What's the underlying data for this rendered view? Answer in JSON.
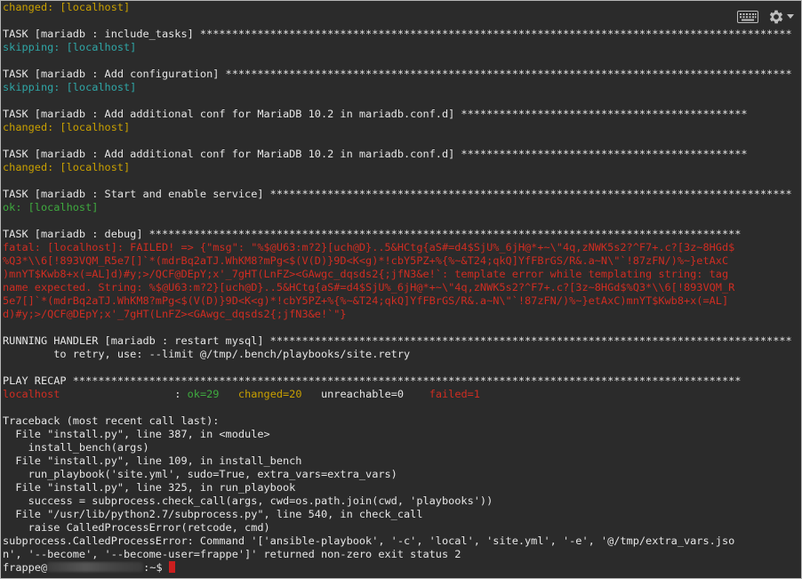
{
  "icons": {
    "keyboard": "keyboard-icon",
    "settings": "gear-icon",
    "dropdown": "caret-down-icon"
  },
  "colors": {
    "background": "#2b2b2b",
    "text": "#e6e6e6",
    "changed": "#c9a000",
    "skipping": "#2fa6a6",
    "ok": "#3faa3f",
    "fatal": "#cf2d22",
    "cursor": "#cc1f1f"
  },
  "terminal": {
    "lines": [
      [
        {
          "t": "changed: [localhost]",
          "c": "changed"
        }
      ],
      [
        {
          "t": "",
          "c": "default"
        }
      ],
      [
        {
          "t": "TASK [mariadb : include_tasks] *********************************************************************************************",
          "c": "default"
        }
      ],
      [
        {
          "t": "skipping: [localhost]",
          "c": "skip"
        }
      ],
      [
        {
          "t": "",
          "c": "default"
        }
      ],
      [
        {
          "t": "TASK [mariadb : Add configuration] *****************************************************************************************",
          "c": "default"
        }
      ],
      [
        {
          "t": "skipping: [localhost]",
          "c": "skip"
        }
      ],
      [
        {
          "t": "",
          "c": "default"
        }
      ],
      [
        {
          "t": "TASK [mariadb : Add additional conf for MariaDB 10.2 in mariadb.conf.d] *********************************************",
          "c": "default"
        }
      ],
      [
        {
          "t": "changed: [localhost]",
          "c": "changed"
        }
      ],
      [
        {
          "t": "",
          "c": "default"
        }
      ],
      [
        {
          "t": "TASK [mariadb : Add additional conf for MariaDB 10.2 in mariadb.conf.d] *********************************************",
          "c": "default"
        }
      ],
      [
        {
          "t": "changed: [localhost]",
          "c": "changed"
        }
      ],
      [
        {
          "t": "",
          "c": "default"
        }
      ],
      [
        {
          "t": "TASK [mariadb : Start and enable service] **********************************************************************************",
          "c": "default"
        }
      ],
      [
        {
          "t": "ok: [localhost]",
          "c": "ok"
        }
      ],
      [
        {
          "t": "",
          "c": "default"
        }
      ],
      [
        {
          "t": "TASK [mariadb : debug] *********************************************************************************************",
          "c": "default"
        }
      ],
      [
        {
          "t": "fatal: [localhost]: FAILED! => {\"msg\": \"%$@U63:m?2}[uch@D}..5&HCtg{aS#=d4$SjU%_6jH@*+~\\\"4q,zNWK5s2?^F7+.c?[3z~8HGd$",
          "c": "fatal"
        }
      ],
      [
        {
          "t": "%Q3*\\\\6[!893VQM_R5e7[]`*(mdrBq2aTJ.WhKM8?mPg<$(V(D)}9D<K<g)*!cbY5PZ+%{%~&T24;qkQ]YfFBrGS/R&.a~N\\\"`!87zFN/)%~}etAxC",
          "c": "fatal"
        }
      ],
      [
        {
          "t": ")mnYT$Kwb8+x(=AL]d)#y;>/QCF@DEpY;x'_7gHT(LnFZ><GAwgc_dqsds2{;jfN3&e!`: template error while templating string: tag",
          "c": "fatal"
        }
      ],
      [
        {
          "t": "name expected. String: %$@U63:m?2}[uch@D}..5&HCtg{aS#=d4$SjU%_6jH@*+~\\\"4q,zNWK5s2?^F7+.c?[3z~8HGd$%Q3*\\\\6[!893VQM_R",
          "c": "fatal"
        }
      ],
      [
        {
          "t": "5e7[]`*(mdrBq2aTJ.WhKM8?mPg<$(V(D)}9D<K<g)*!cbY5PZ+%{%~&T24;qkQ]YfFBrGS/R&.a~N\\\"`!87zFN/)%~}etAxC)mnYT$Kwb8+x(=AL]",
          "c": "fatal"
        }
      ],
      [
        {
          "t": "d)#y;>/QCF@DEpY;x'_7gHT(LnFZ><GAwgc_dqsds2{;jfN3&e!`\"}",
          "c": "fatal"
        }
      ],
      [
        {
          "t": "",
          "c": "default"
        }
      ],
      [
        {
          "t": "RUNNING HANDLER [mariadb : restart mysql] **********************************************************************************",
          "c": "default"
        }
      ],
      [
        {
          "t": "        to retry, use: --limit @/tmp/.bench/playbooks/site.retry",
          "c": "default"
        }
      ],
      [
        {
          "t": "",
          "c": "default"
        }
      ],
      [
        {
          "t": "PLAY RECAP *********************************************************************************************************",
          "c": "default"
        }
      ],
      [
        {
          "t": "localhost",
          "c": "fatal"
        },
        {
          "t": "                  : ",
          "c": "default"
        },
        {
          "t": "ok=29",
          "c": "ok"
        },
        {
          "t": "   ",
          "c": "default"
        },
        {
          "t": "changed=20",
          "c": "changed"
        },
        {
          "t": "   unreachable=0    ",
          "c": "default"
        },
        {
          "t": "failed=1",
          "c": "fatal"
        }
      ],
      [
        {
          "t": "",
          "c": "default"
        }
      ],
      [
        {
          "t": "Traceback (most recent call last):",
          "c": "default"
        }
      ],
      [
        {
          "t": "  File \"install.py\", line 387, in <module>",
          "c": "default"
        }
      ],
      [
        {
          "t": "    install_bench(args)",
          "c": "default"
        }
      ],
      [
        {
          "t": "  File \"install.py\", line 109, in install_bench",
          "c": "default"
        }
      ],
      [
        {
          "t": "    run_playbook('site.yml', sudo=True, extra_vars=extra_vars)",
          "c": "default"
        }
      ],
      [
        {
          "t": "  File \"install.py\", line 325, in run_playbook",
          "c": "default"
        }
      ],
      [
        {
          "t": "    success = subprocess.check_call(args, cwd=os.path.join(cwd, 'playbooks'))",
          "c": "default"
        }
      ],
      [
        {
          "t": "  File \"/usr/lib/python2.7/subprocess.py\", line 540, in check_call",
          "c": "default"
        }
      ],
      [
        {
          "t": "    raise CalledProcessError(retcode, cmd)",
          "c": "default"
        }
      ],
      [
        {
          "t": "subprocess.CalledProcessError: Command '['ansible-playbook', '-c', 'local', 'site.yml', '-e', '@/tmp/extra_vars.jso",
          "c": "default"
        }
      ],
      [
        {
          "t": "n', '--become', '--become-user=frappe']' returned non-zero exit status 2",
          "c": "default"
        }
      ]
    ],
    "prompt": {
      "user": "frappe@",
      "suffix": ":~$ "
    }
  }
}
